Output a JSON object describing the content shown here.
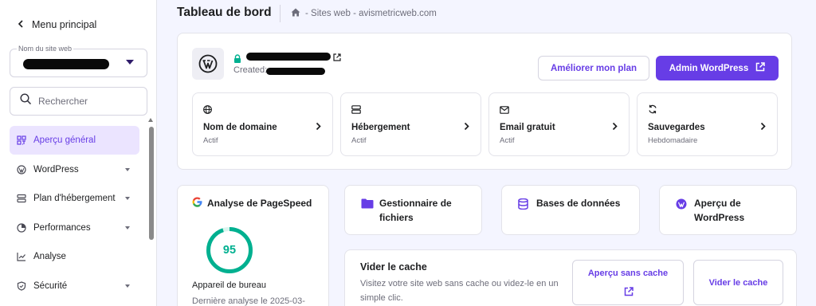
{
  "sidebar": {
    "back_label": "Menu principal",
    "site_select": {
      "label": "Nom du site web"
    },
    "search_placeholder": "Rechercher",
    "items": [
      {
        "label": "Aperçu général",
        "icon": "grid-icon",
        "active": true
      },
      {
        "label": "WordPress",
        "icon": "wordpress-icon"
      },
      {
        "label": "Plan d'hébergement",
        "icon": "server-icon"
      },
      {
        "label": "Performances",
        "icon": "gauge-icon"
      },
      {
        "label": "Analyse",
        "icon": "chart-line-icon"
      },
      {
        "label": "Sécurité",
        "icon": "shield-icon"
      }
    ]
  },
  "header": {
    "title": "Tableau de bord",
    "breadcrumb": "- Sites web - avismetricweb.com"
  },
  "site": {
    "created_label": "Created:",
    "upgrade_label": "Améliorer mon plan",
    "admin_label": "Admin WordPress"
  },
  "tiles": [
    {
      "title": "Nom de domaine",
      "sub": "Actif",
      "icon": "globe-icon"
    },
    {
      "title": "Hébergement",
      "sub": "Actif",
      "icon": "server-icon"
    },
    {
      "title": "Email gratuit",
      "sub": "Actif",
      "icon": "mail-icon"
    },
    {
      "title": "Sauvegardes",
      "sub": "Hebdomadaire",
      "icon": "sync-icon"
    }
  ],
  "pagespeed": {
    "title": "Analyse de PageSpeed",
    "score": "95",
    "score_fraction": 0.95,
    "device": "Appareil de bureau",
    "last": "Dernière analyse le 2025-03-"
  },
  "features": [
    {
      "label": "Gestionnaire de fichiers",
      "icon": "folder-icon"
    },
    {
      "label": "Bases de données",
      "icon": "database-icon"
    },
    {
      "label": "Aperçu de WordPress",
      "icon": "wordpress-icon"
    }
  ],
  "cache": {
    "title": "Vider le cache",
    "desc": "Visitez votre site web sans cache ou videz-le en un simple clic.",
    "preview_label": "Aperçu sans cache",
    "clear_label": "Vider le cache"
  },
  "colors": {
    "accent": "#673de6",
    "success": "#00b090",
    "text": "#1d1e20",
    "muted": "#6d6d7a"
  }
}
